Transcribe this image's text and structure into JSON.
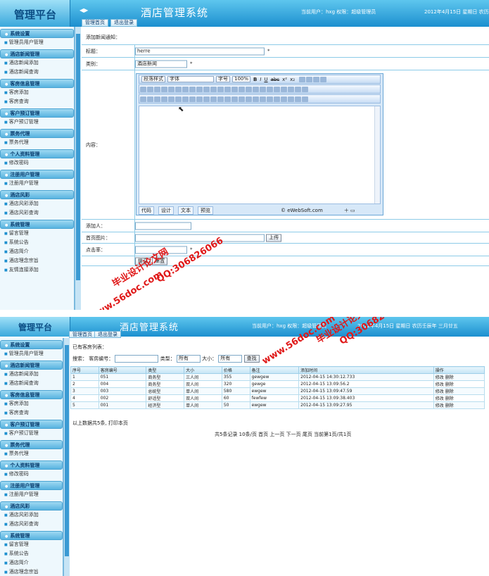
{
  "app": {
    "logo": "管理平台",
    "system_title": "酒店管理系统",
    "collapse_icon": "◀▶",
    "user_info": "当前用户：hxg 权限：超级管理员",
    "date_info": "2012年4月15日 星期日 农历",
    "date_info_full": "2012年4月15日 星期日 农历壬辰年 三月廿五",
    "nav": [
      "管理首页",
      "退出登录"
    ]
  },
  "sidebar": [
    {
      "group": "系统设置",
      "items": [
        "管理员用户管理"
      ]
    },
    {
      "group": "酒店新闻管理",
      "items": [
        "酒店新闻添加",
        "酒店新闻查询"
      ]
    },
    {
      "group": "客房信息管理",
      "items": [
        "客房添加",
        "客房查询"
      ]
    },
    {
      "group": "客户预订管理",
      "items": [
        "客户预订管理"
      ]
    },
    {
      "group": "票务代理",
      "items": [
        "票务代理"
      ]
    },
    {
      "group": "个人资料管理",
      "items": [
        "修改密码"
      ]
    },
    {
      "group": "注册用户管理",
      "items": [
        "注册用户管理"
      ]
    },
    {
      "group": "酒店风彩",
      "items": [
        "酒店风彩添加",
        "酒店风彩查询"
      ]
    },
    {
      "group": "系统管理",
      "items": [
        "留言管理",
        "系统公告",
        "酒店简介",
        "酒店理念宗旨",
        "友情连接添加"
      ]
    }
  ],
  "form": {
    "heading": "添加新闻通知：",
    "title_label": "标题：",
    "title_value": "herre",
    "category_label": "类别：",
    "category_value": "酒店新闻",
    "content_label": "内容：",
    "adder_label": "添加人：",
    "image_label": "首页图片：",
    "upload_button": "上传",
    "clicks_label": "点击率：",
    "submit_button": "提交",
    "reset_button": "重置",
    "required_mark": "*"
  },
  "editor": {
    "paragraph_style": "段落样式",
    "font": "字体",
    "font_size": "字号",
    "zoom": "100%",
    "bold": "B",
    "italic": "I",
    "underline": "U",
    "strike": "abc",
    "superscript": "x²",
    "subscript": "x₂",
    "tab_code": "代码",
    "tab_design": "设计",
    "tab_text": "文本",
    "tab_preview": "预览",
    "credit": "© eWebSoft.com"
  },
  "list": {
    "heading": "已有客房列表：",
    "search_label": "搜索：",
    "room_no_label": "客房编号：",
    "type_label": "类型：",
    "type_value": "所有",
    "size_label": "大小：",
    "size_value": "所有",
    "search_button": "查找",
    "columns": [
      "序号",
      "客房编号",
      "类型",
      "大小",
      "价格",
      "备注",
      "添加时间",
      "操作"
    ],
    "rows": [
      [
        "1",
        "051",
        "商务型",
        "三人间",
        "355",
        "gewgew",
        "2012-04-15 14:30:12.733",
        "修改 删除"
      ],
      [
        "2",
        "004",
        "商务型",
        "双人间",
        "320",
        "gewge",
        "2012-04-15 13:09:56.2",
        "修改 删除"
      ],
      [
        "3",
        "003",
        "总统型",
        "单人间",
        "580",
        "ewgew",
        "2012-04-15 13:09:47.59",
        "修改 删除"
      ],
      [
        "4",
        "002",
        "舒适型",
        "双人间",
        "60",
        "fewfew",
        "2012-04-15 13:09:38.403",
        "修改 删除"
      ],
      [
        "5",
        "001",
        "经济型",
        "单人间",
        "50",
        "ewgew",
        "2012-04-15 13:09:27.95",
        "修改 删除"
      ]
    ],
    "summary": "以上数据共5条, 打印本页",
    "pagination": "共5条记录  10条/页  首页  上一页  下一页  尾页  当前第1页/共1页"
  },
  "watermarks": [
    "毕业设计论文网",
    "QQ:306826066",
    "www.56doc.com"
  ]
}
